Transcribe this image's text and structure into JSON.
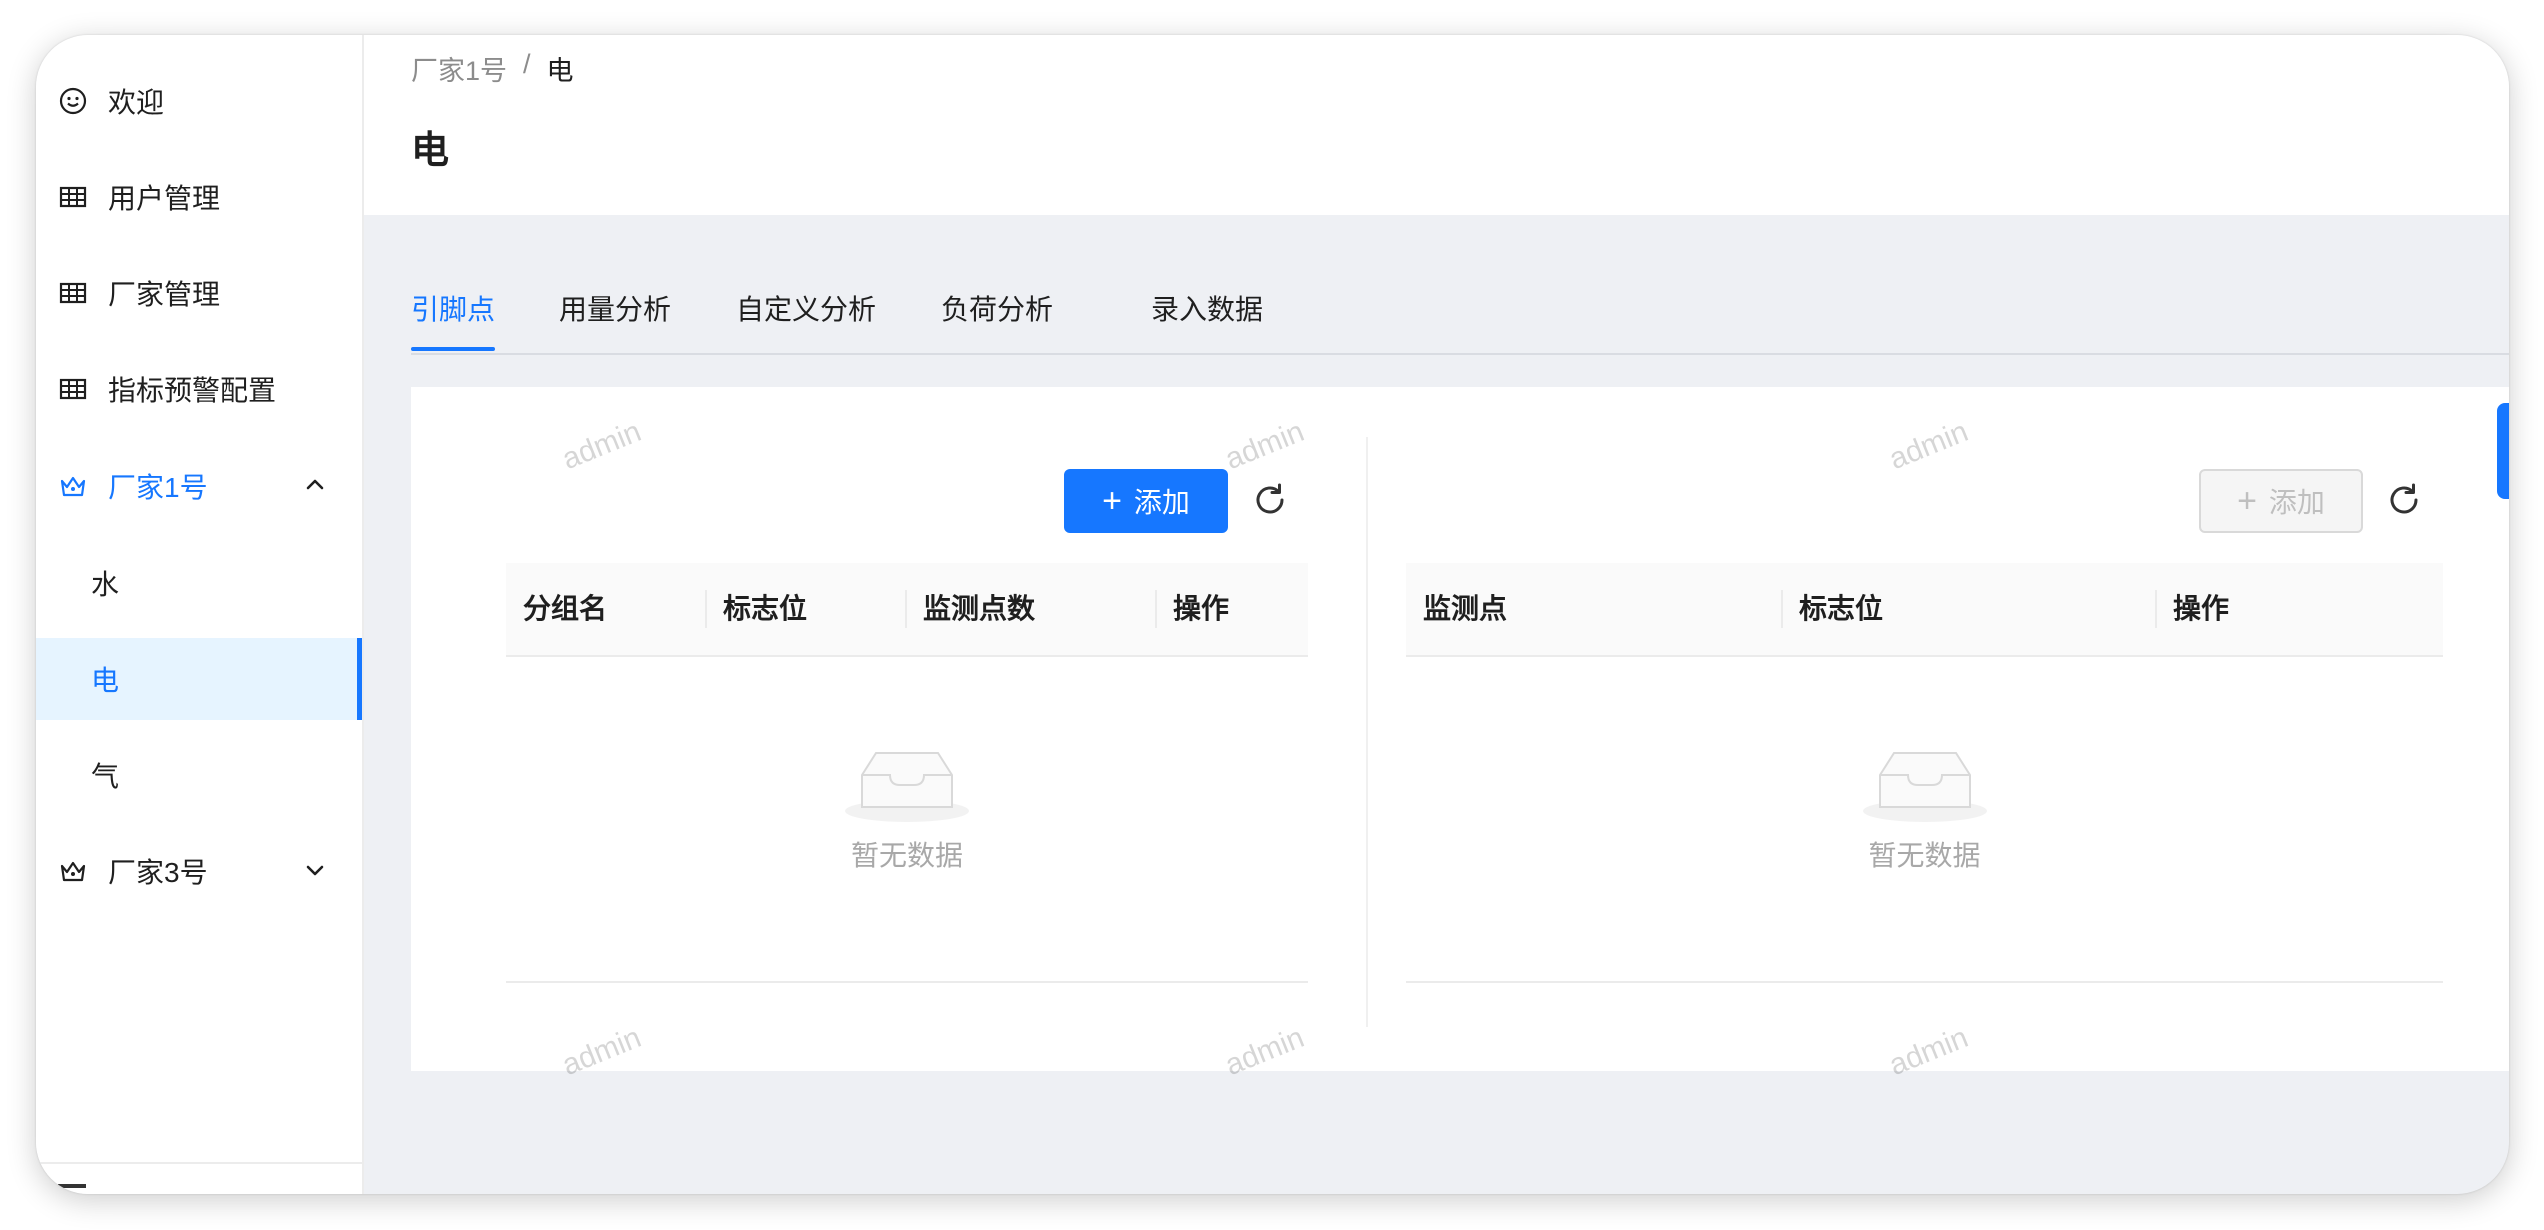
{
  "sidebar": {
    "items": [
      {
        "label": "欢迎",
        "icon": "smile-icon"
      },
      {
        "label": "用户管理",
        "icon": "table-icon"
      },
      {
        "label": "厂家管理",
        "icon": "table-icon"
      },
      {
        "label": "指标预警配置",
        "icon": "table-icon"
      },
      {
        "label": "厂家1号",
        "icon": "crown-icon",
        "expanded": true
      },
      {
        "label": "水"
      },
      {
        "label": "电",
        "selected": true
      },
      {
        "label": "气"
      },
      {
        "label": "厂家3号",
        "icon": "crown-icon",
        "expanded": false
      }
    ]
  },
  "breadcrumb": {
    "parent": "厂家1号",
    "separator": "/",
    "current": "电"
  },
  "page": {
    "title": "电"
  },
  "tabs": [
    "引脚点",
    "用量分析",
    "自定义分析",
    "负荷分析",
    "录入数据"
  ],
  "active_tab": "引脚点",
  "left_panel": {
    "add_label": "添加",
    "columns": [
      "分组名",
      "标志位",
      "监测点数",
      "操作"
    ],
    "empty_text": "暂无数据"
  },
  "right_panel": {
    "add_label": "添加",
    "columns": [
      "监测点",
      "标志位",
      "操作"
    ],
    "empty_text": "暂无数据"
  },
  "watermark": "admin",
  "colors": {
    "primary": "#1677ff",
    "selected_bg": "#e6f4ff",
    "content_bg": "#eef0f4"
  }
}
